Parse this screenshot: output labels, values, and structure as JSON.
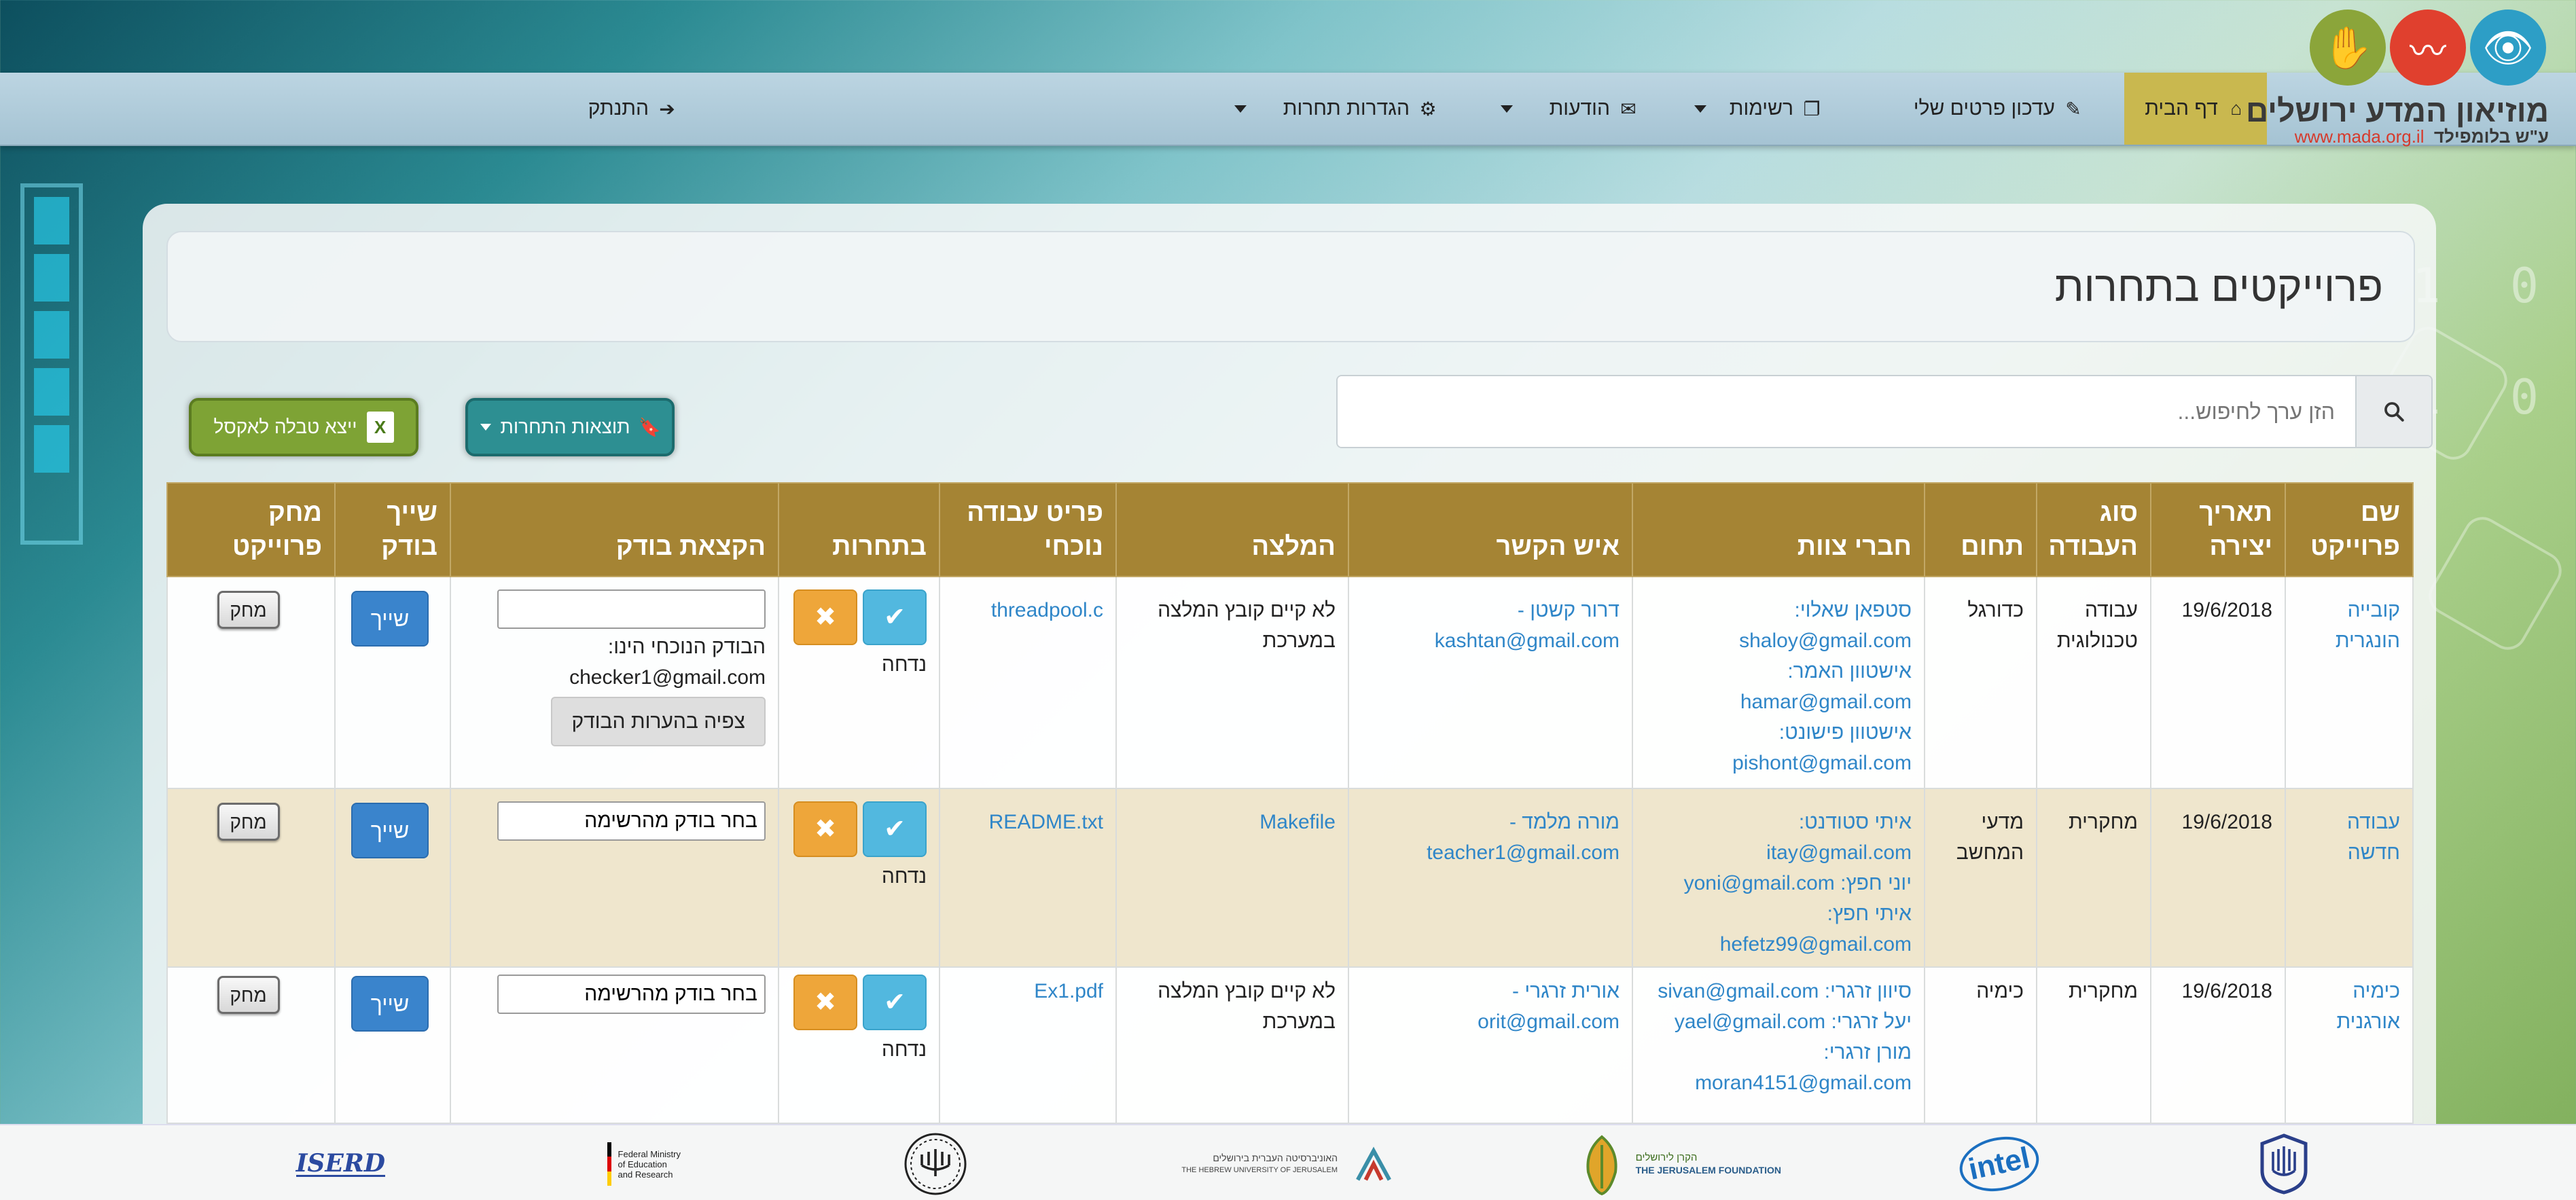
{
  "logo": {
    "title": "מוזיאון המדע ירושלים",
    "subtitle_prefix": "ע\"ש בלומפילד",
    "url": "www.mada.org.il"
  },
  "nav": {
    "home": "דף הבית",
    "update": "עדכון פרטים שלי",
    "lists": "רשימות",
    "messages": "הודעות",
    "settings": "הגדרות תחרות",
    "logout": "התנתק"
  },
  "page": {
    "title": "פרוייקטים בתחרות"
  },
  "search": {
    "placeholder": "הזן ערך לחיפוש..."
  },
  "buttons": {
    "results": "תוצאות התחרות",
    "excel": "ייצא טבלה לאקסל"
  },
  "table": {
    "headers": {
      "name": "שם פרוייקט",
      "date": "תאריך יצירה",
      "type": "סוג העבודה",
      "field": "תחום",
      "members": "חברי צוות",
      "contact": "איש הקשר",
      "recommendation": "המלצה",
      "current": "פריט עבודה נוכחי",
      "competition": "בתחרות",
      "checker": "הקצאת בודק",
      "assign": "שייך בודק",
      "delete": "מחק פרוייקט"
    },
    "rows": [
      {
        "name": "קובייה הונגרית",
        "date": "19/6/2018",
        "type": "עבודה טכנולוגית",
        "field": "כדורגל",
        "members": [
          "סטפאן שאלוי:",
          "shaloy@gmail.com",
          "אישטוון האמר:",
          "hamar@gmail.com",
          "אישטוון פישונט:",
          "pishont@gmail.com"
        ],
        "contact": [
          "דרור קשטן -",
          "kashtan@gmail.com"
        ],
        "recommendation": "לא קיים קובץ המלצה במערכת",
        "current": "threadpool.c",
        "competition_state": "נדחה",
        "checker_value": "",
        "checker_current": "הבודק הנוכחי הינו: checker1@gmail.com",
        "view_label": "צפיה בהערות הבודק",
        "assign_label": "שייך",
        "delete_label": "מחק"
      },
      {
        "name": "עבודה חדשה",
        "date": "19/6/2018",
        "type": "מחקרית",
        "field": "מדעי המחשב",
        "members": [
          "איתי סטודנט:",
          "itay@gmail.com",
          "יוני חפץ: yoni@gmail.com",
          "איתי חפץ:",
          "hefetz99@gmail.com"
        ],
        "contact": [
          "מורה מלמד -",
          "teacher1@gmail.com"
        ],
        "recommendation": "Makefile",
        "current": "README.txt",
        "competition_state": "נדחה",
        "checker_value": "בחר בודק מהרשימה",
        "assign_label": "שייך",
        "delete_label": "מחק"
      },
      {
        "name": "כימיה אורגנית",
        "date": "19/6/2018",
        "type": "מחקרית",
        "field": "כימיה",
        "members": [
          "סיוון זרגרי: sivan@gmail.com",
          "יעל זרגרי: yael@gmail.com",
          "מורן זרגרי:",
          "moran4151@gmail.com"
        ],
        "contact": [
          "אורית זרגרי -",
          "orit@gmail.com"
        ],
        "recommendation": "לא קיים קובץ המלצה במערכת",
        "current": "Ex1.pdf",
        "competition_state": "נדחה",
        "checker_value": "בחר בודק מהרשימה",
        "assign_label": "שייך",
        "delete_label": "מחק"
      }
    ]
  },
  "footer": {
    "hebrew_university": "האוניברסיטה העברית בירושלים",
    "hebrew_university_en": "THE HEBREW UNIVERSITY OF JERUSALEM",
    "jerusalem_foundation": "THE JERUSALEM FOUNDATION",
    "jerusalem_foundation_he": "הקרן לירושלים",
    "bmbf_1": "Federal Ministry",
    "bmbf_2": "of Education",
    "bmbf_3": "and Research",
    "intel": "intel",
    "iserd": "ISERD"
  }
}
